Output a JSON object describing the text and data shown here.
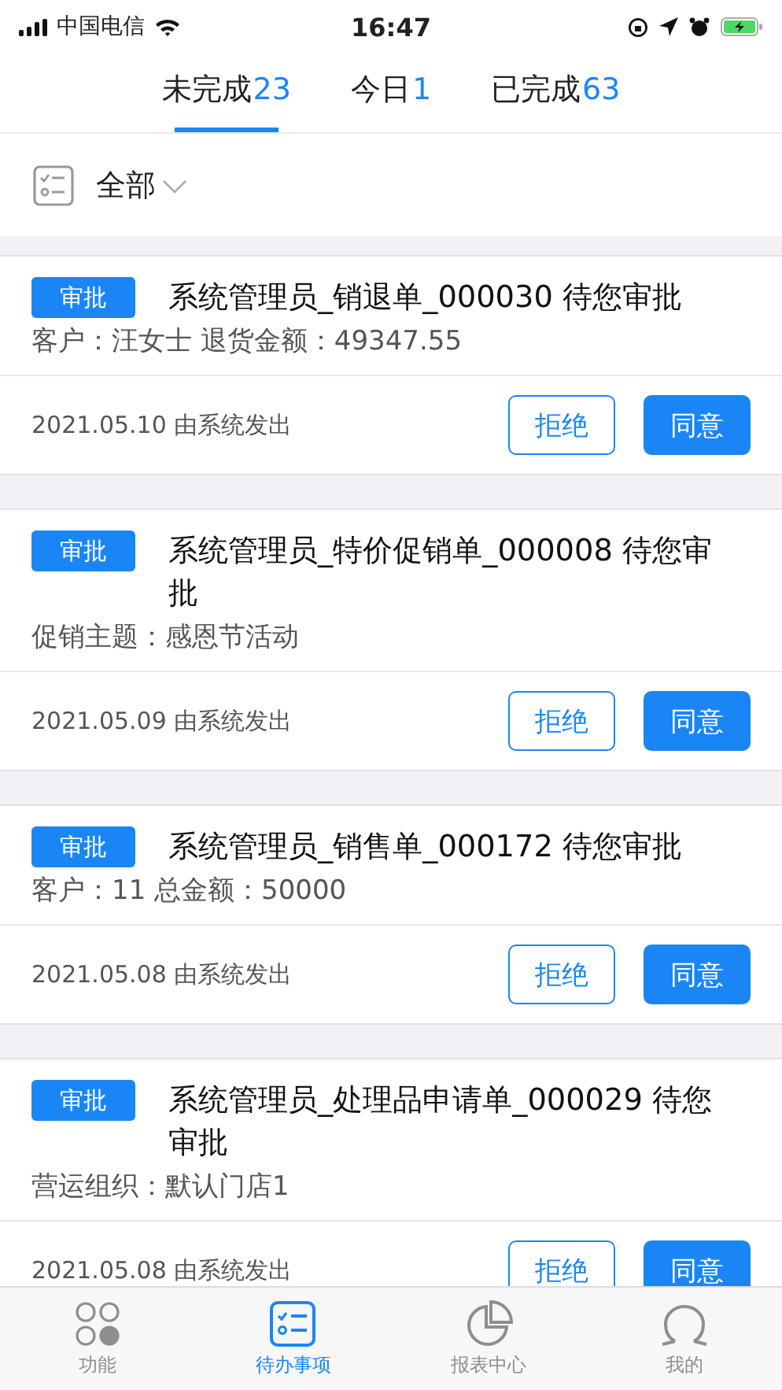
{
  "status_bar": {
    "carrier": "中国电信",
    "time": "16:47"
  },
  "tabs": [
    {
      "label": "未完成",
      "count": "23",
      "selected": true
    },
    {
      "label": "今日",
      "count": "1",
      "selected": false
    },
    {
      "label": "已完成",
      "count": "63",
      "selected": false
    }
  ],
  "filter": {
    "label": "全部"
  },
  "tasks": [
    {
      "tag": "审批",
      "title": "系统管理员_销退单_000030 待您审批",
      "detail": "客户：汪女士 退货金额：49347.55",
      "footer": "2021.05.10 由系统发出",
      "reject": "拒绝",
      "approve": "同意"
    },
    {
      "tag": "审批",
      "title": "系统管理员_特价促销单_000008 待您审批",
      "detail": "促销主题：感恩节活动",
      "footer": "2021.05.09 由系统发出",
      "reject": "拒绝",
      "approve": "同意"
    },
    {
      "tag": "审批",
      "title": "系统管理员_销售单_000172 待您审批",
      "detail": "客户：11 总金额：50000",
      "footer": "2021.05.08 由系统发出",
      "reject": "拒绝",
      "approve": "同意"
    },
    {
      "tag": "审批",
      "title": "系统管理员_处理品申请单_000029 待您审批",
      "detail": "营运组织：默认门店1",
      "footer": "2021.05.08 由系统发出",
      "reject": "拒绝",
      "approve": "同意"
    }
  ],
  "bottom_nav": [
    {
      "kind": "grid",
      "label": "功能",
      "selected": false
    },
    {
      "kind": "list",
      "label": "待办事项",
      "selected": true
    },
    {
      "kind": "pie",
      "label": "报表中心",
      "selected": false
    },
    {
      "kind": "person",
      "label": "我的",
      "selected": false
    }
  ]
}
